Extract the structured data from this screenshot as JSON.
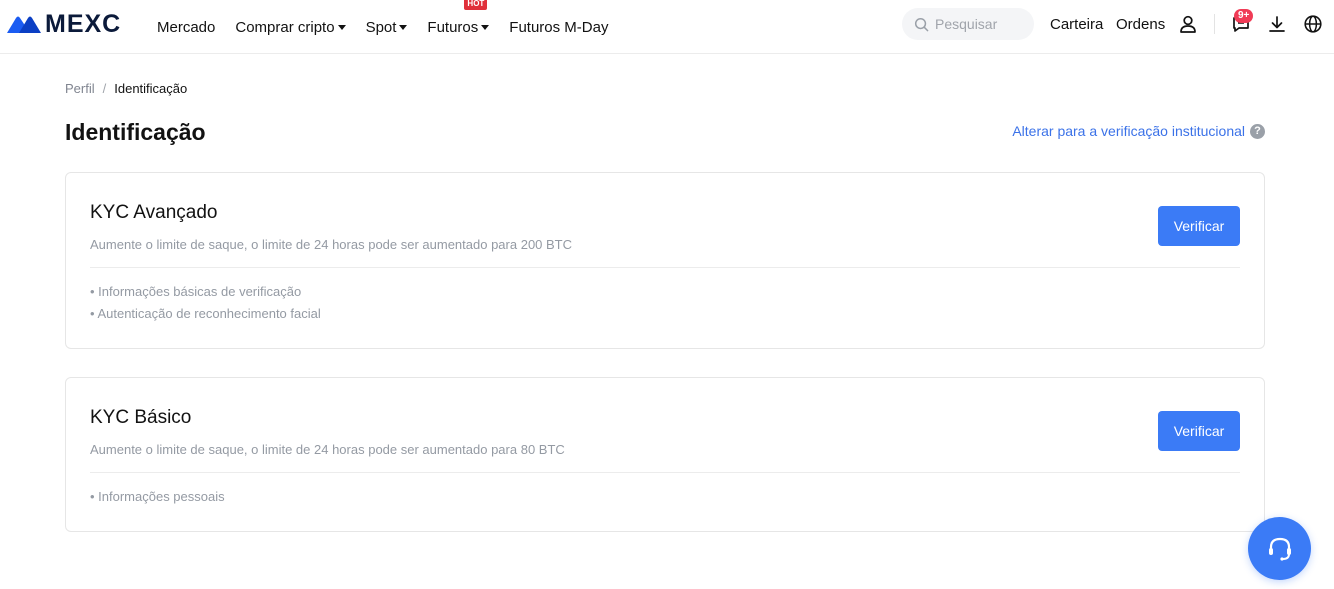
{
  "header": {
    "logo_text": "MEXC",
    "nav": [
      {
        "label": "Mercado"
      },
      {
        "label": "Comprar cripto"
      },
      {
        "label": "Spot"
      },
      {
        "label": "Futuros",
        "badge": "HOT"
      },
      {
        "label": "Futuros M-Day"
      }
    ],
    "search_placeholder": "Pesquisar",
    "wallet": "Carteira",
    "orders": "Ordens",
    "notifications_badge": "9+",
    "icons": [
      "user-icon",
      "chat-icon",
      "download-icon",
      "globe-icon"
    ]
  },
  "breadcrumb": {
    "parent": "Perfil",
    "separator": "/",
    "current": "Identificação"
  },
  "page": {
    "title": "Identificação",
    "institutional_link": "Alterar para a verificação institucional",
    "help": "?"
  },
  "cards": [
    {
      "title": "KYC Avançado",
      "description": "Aumente o limite de saque, o limite de 24 horas pode ser aumentado para 200 BTC",
      "features": [
        "• Informações básicas de verificação",
        "• Autenticação de reconhecimento facial"
      ],
      "button": "Verificar"
    },
    {
      "title": "KYC Básico",
      "description": "Aumente o limite de saque, o limite de 24 horas pode ser aumentado para 80 BTC",
      "features": [
        "• Informações pessoais"
      ],
      "button": "Verificar"
    }
  ],
  "colors": {
    "accent": "#3b7bf6",
    "link": "#3b72e8",
    "hot": "#e0303a"
  }
}
